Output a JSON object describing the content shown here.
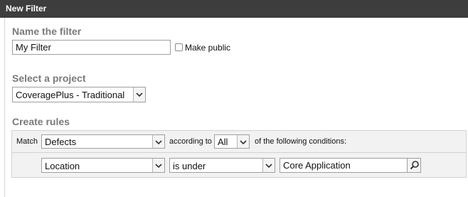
{
  "dialog": {
    "title": "New Filter"
  },
  "name_section": {
    "heading": "Name the filter",
    "name_value": "My Filter",
    "make_public_label": "Make public",
    "make_public_checked": false
  },
  "project_section": {
    "heading": "Select a project",
    "selected_project": "CoveragePlus - Traditional"
  },
  "rules_section": {
    "heading": "Create rules",
    "match_label": "Match",
    "match_type": "Defects",
    "according_to_label": "according to",
    "quantifier": "All",
    "conditions_label": "of the following conditions:",
    "condition": {
      "field": "Location",
      "operator": "is under",
      "value": "Core Application"
    }
  },
  "icons": {
    "dropdown": "chevron-down-icon",
    "search": "magnifier-icon"
  }
}
